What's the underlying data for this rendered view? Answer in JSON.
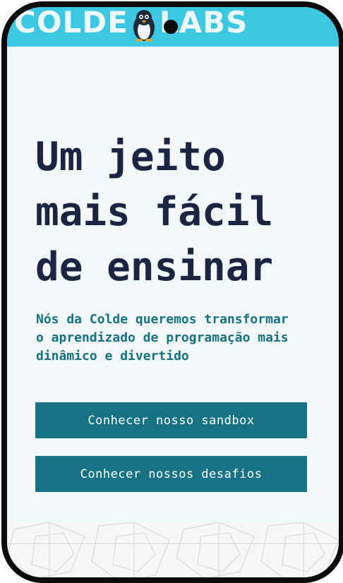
{
  "header": {
    "logo_text_left": "COLDE",
    "logo_text_right": "LABS",
    "logo_icon": "penguin-icon",
    "color": "#3ec7e3"
  },
  "hero": {
    "title": "Um jeito mais fácil de ensinar",
    "subtitle": "Nós da Colde queremos transformar o aprendizado de programação mais dinâmico e divertido"
  },
  "buttons": {
    "sandbox_label": "Conhecer nosso sandbox",
    "desafios_label": "Conhecer nossos desafios",
    "color": "#177383"
  },
  "footer": {
    "pattern": "geometric-penguin-pattern"
  }
}
